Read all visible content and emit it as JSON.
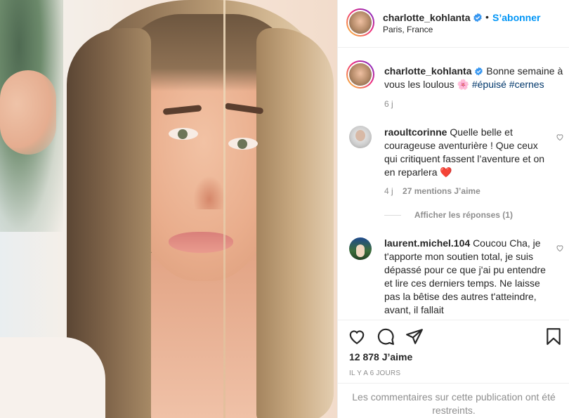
{
  "post": {
    "username": "charlotte_kohlanta",
    "follow_label": "S’abonner",
    "separator": "•",
    "location": "Paris, France"
  },
  "caption": {
    "username": "charlotte_kohlanta",
    "text": "Bonne semaine à vous les loulous",
    "emoji": "🌸",
    "hashtags": [
      "#épuisé",
      "#cernes"
    ],
    "time": "6 j"
  },
  "comments": [
    {
      "username": "raoultcorinne",
      "text": "Quelle belle et courageuse aventurière ! Que ceux qui critiquent fassent l’aventure et on en reparlera",
      "emoji": "❤️",
      "time": "4 j",
      "likes": "27 mentions J’aime",
      "replies": "Afficher les réponses (1)"
    },
    {
      "username": "laurent.michel.104",
      "text": "Coucou Cha, je t'apporte mon soutien total, je suis dépassé pour ce que j'ai pu entendre et lire ces derniers temps. Ne laisse pas la bêtise des autres t'atteindre, avant, il fallait"
    }
  ],
  "footer": {
    "likes": "12 878 J’aime",
    "date": "IL Y A 6 JOURS",
    "restricted": "Les commentaires sur cette publication ont été restreints."
  },
  "icons": {
    "like": "heart-icon",
    "comment": "comment-icon",
    "share": "share-icon",
    "save": "bookmark-icon",
    "verified": "verified-badge-icon"
  },
  "colors": {
    "accent_blue": "#0095f6",
    "verified_blue": "#3897f0",
    "hashtag": "#00376b",
    "muted": "#8e8e8e",
    "heart_red": "#ed4956"
  }
}
